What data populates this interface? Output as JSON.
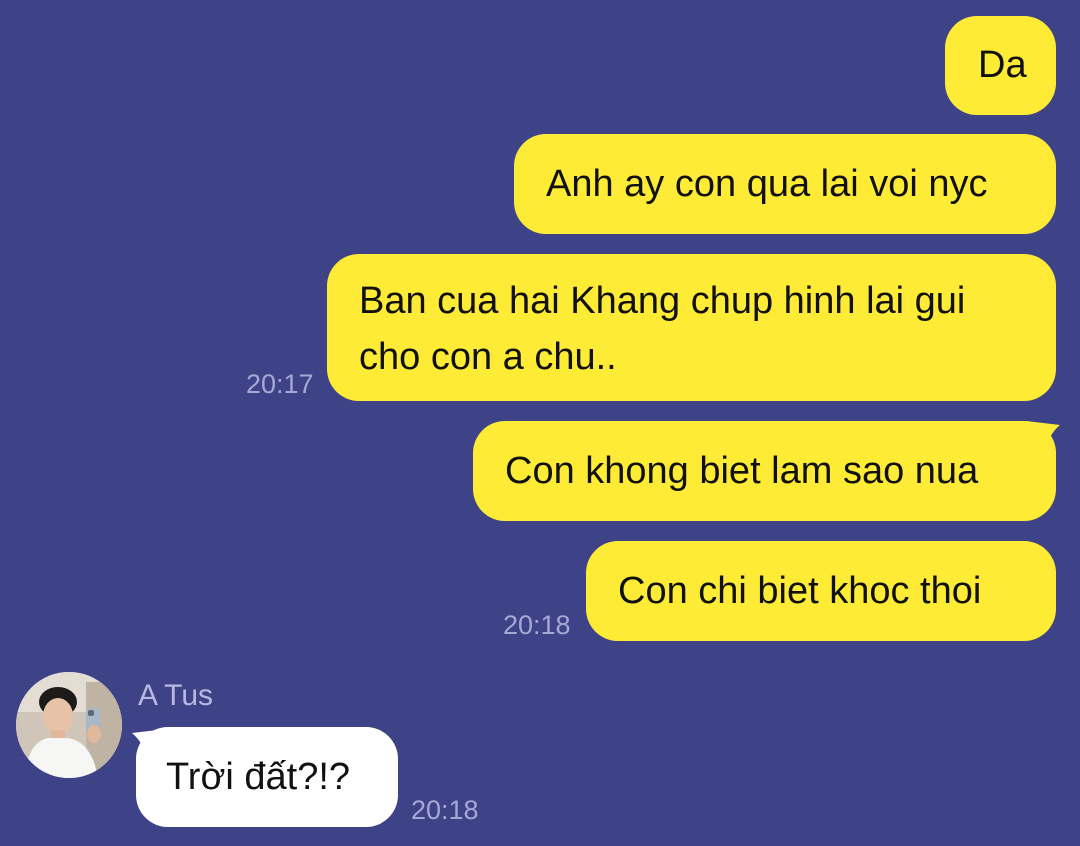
{
  "colors": {
    "background": "#3e4287",
    "outgoing_bubble": "#fdeb36",
    "incoming_bubble": "#ffffff",
    "timestamp": "#a6a8d4"
  },
  "messages": [
    {
      "direction": "outgoing",
      "text": "Da"
    },
    {
      "direction": "outgoing",
      "text": "Anh ay con qua lai voi nyc"
    },
    {
      "direction": "outgoing",
      "text": "Ban cua hai Khang chup hinh lai gui cho con a chu..",
      "line1": "Ban cua hai Khang chup hinh lai gui",
      "line2": "cho con a chu..",
      "time": "20:17"
    },
    {
      "direction": "outgoing",
      "text": "Con khong biet lam sao nua"
    },
    {
      "direction": "outgoing",
      "text": "Con chi biet khoc thoi",
      "time": "20:18"
    },
    {
      "direction": "incoming",
      "sender": "A Tus",
      "avatar_icon": "user-avatar-photo",
      "text": "Trời đất?!?",
      "time": "20:18"
    }
  ]
}
